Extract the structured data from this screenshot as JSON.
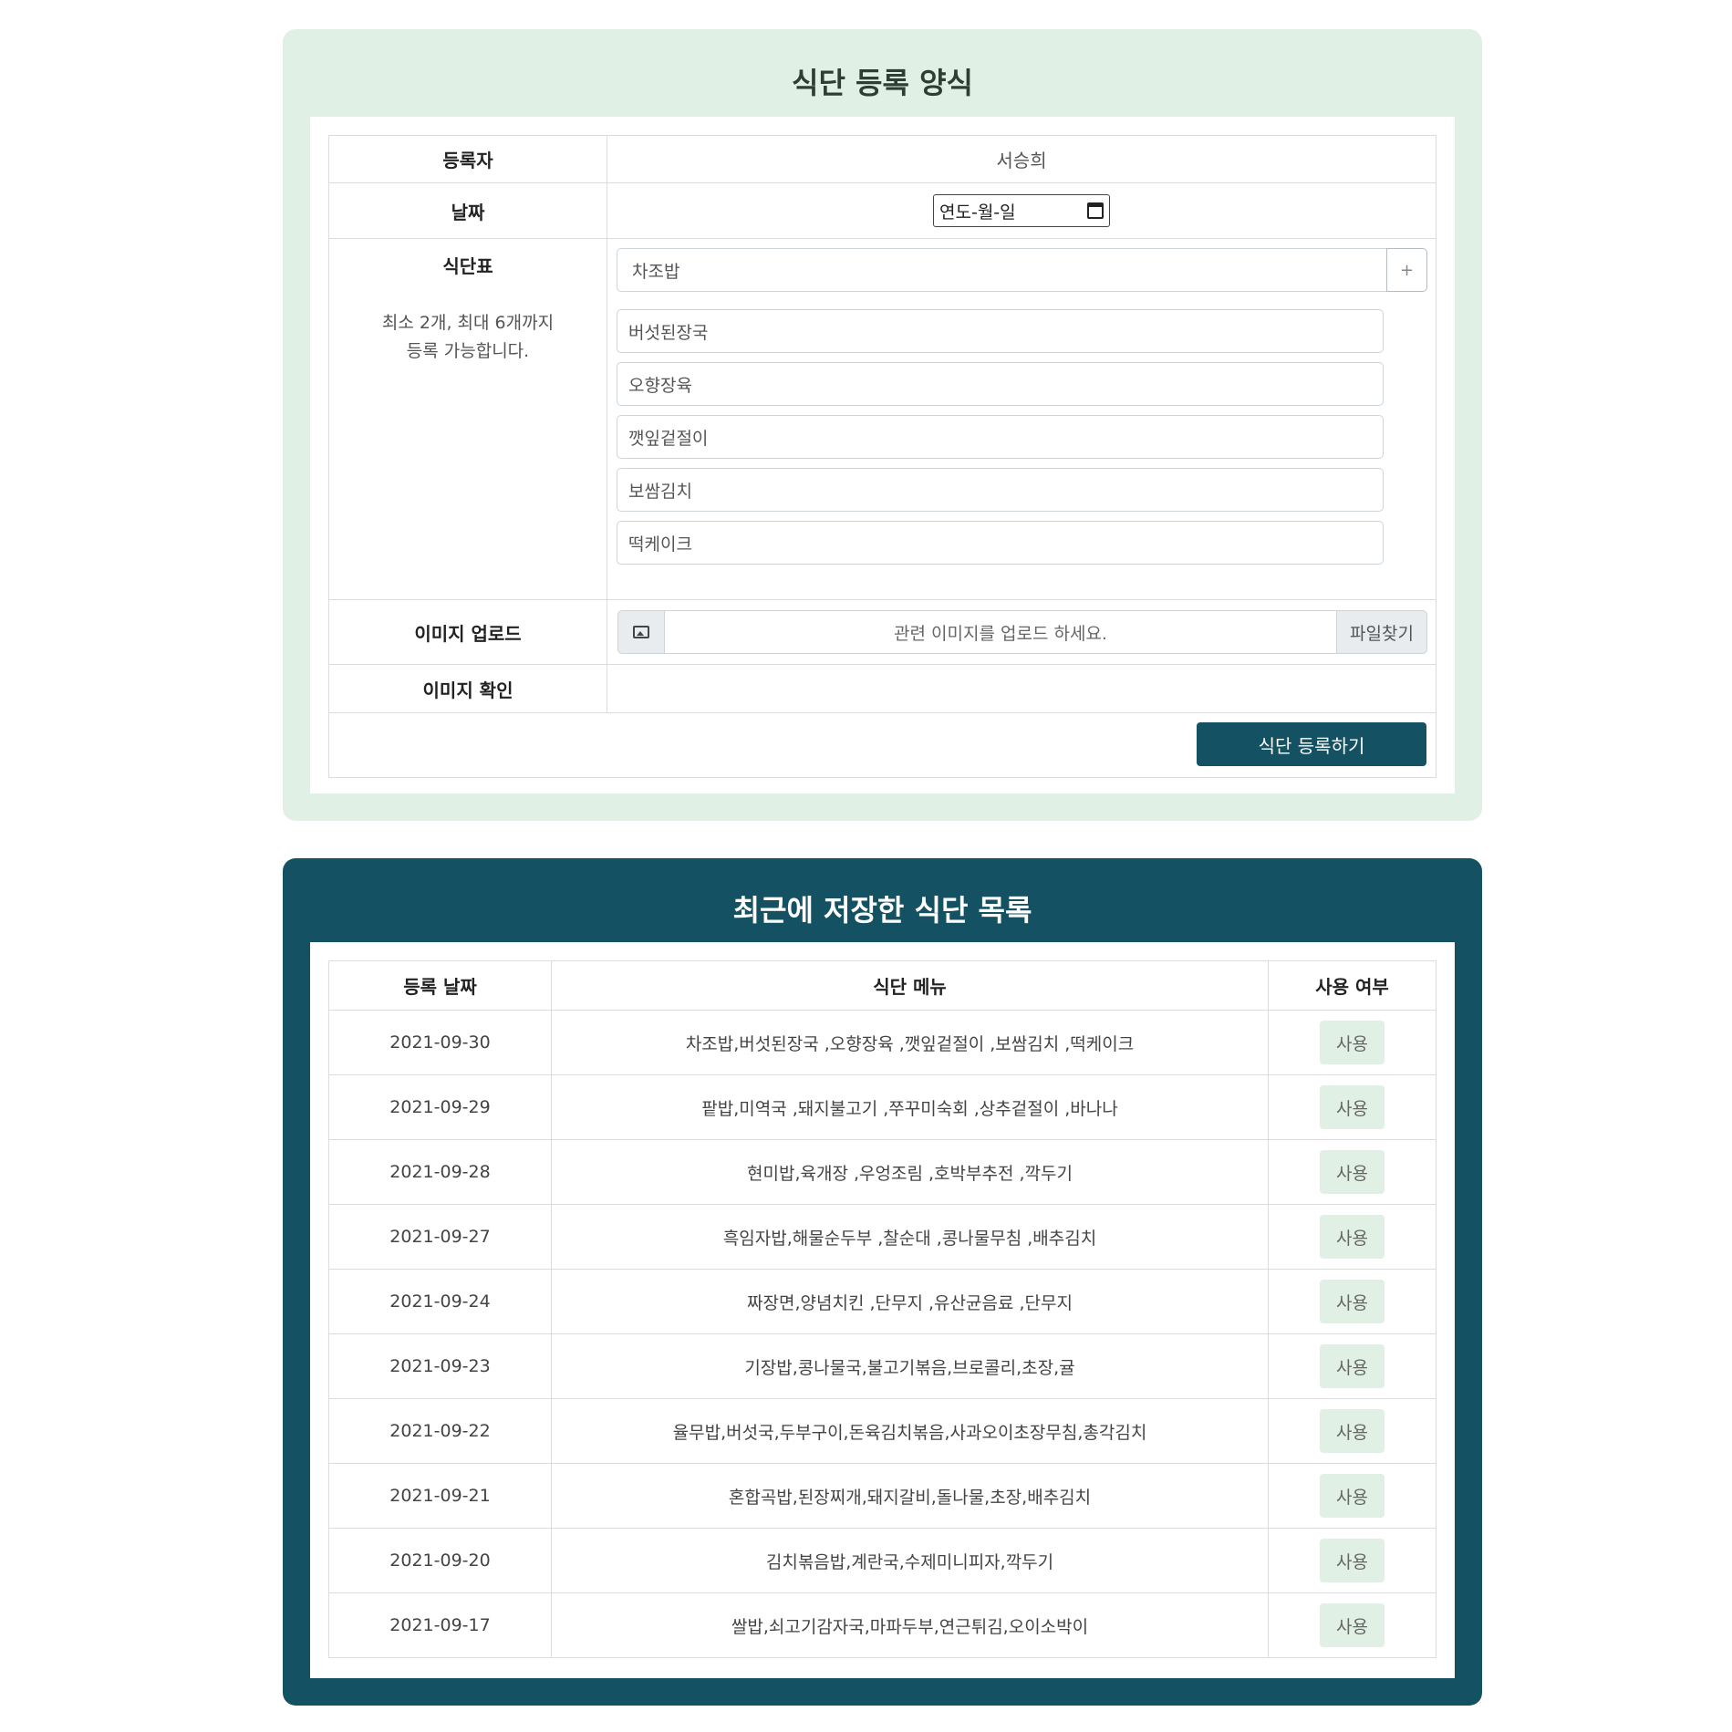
{
  "form": {
    "title": "식단 등록 양식",
    "registrant_label": "등록자",
    "registrant_value": "서승희",
    "date_label": "날짜",
    "date_placeholder": "연도-월-일",
    "menu_label": "식단표",
    "menu_hint_line1": "최소 2개, 최대 6개까지",
    "menu_hint_line2": "등록 가능합니다.",
    "menu_items": [
      "차조밥",
      "버섯된장국",
      "오향장육",
      "깻잎겉절이",
      "보쌈김치",
      "떡케이크"
    ],
    "add_button": "+",
    "image_upload_label": "이미지 업로드",
    "image_upload_placeholder": "관련 이미지를 업로드 하세요.",
    "file_button": "파일찾기",
    "image_check_label": "이미지 확인",
    "submit_button": "식단 등록하기"
  },
  "list": {
    "title": "최근에 저장한 식단 목록",
    "headers": [
      "등록 날짜",
      "식단 메뉴",
      "사용 여부"
    ],
    "rows": [
      {
        "date": "2021-09-30",
        "menu": "차조밥,버섯된장국 ,오향장육 ,깻잎겉절이 ,보쌈김치 ,떡케이크",
        "use": "사용"
      },
      {
        "date": "2021-09-29",
        "menu": "팥밥,미역국 ,돼지불고기 ,쭈꾸미숙회 ,상추겉절이 ,바나나",
        "use": "사용"
      },
      {
        "date": "2021-09-28",
        "menu": "현미밥,육개장 ,우엉조림 ,호박부추전 ,깍두기",
        "use": "사용"
      },
      {
        "date": "2021-09-27",
        "menu": "흑임자밥,해물순두부 ,찰순대 ,콩나물무침 ,배추김치",
        "use": "사용"
      },
      {
        "date": "2021-09-24",
        "menu": "짜장면,양념치킨 ,단무지 ,유산균음료 ,단무지",
        "use": "사용"
      },
      {
        "date": "2021-09-23",
        "menu": "기장밥,콩나물국,불고기볶음,브로콜리,초장,귤",
        "use": "사용"
      },
      {
        "date": "2021-09-22",
        "menu": "율무밥,버섯국,두부구이,돈육김치볶음,사과오이초장무침,총각김치",
        "use": "사용"
      },
      {
        "date": "2021-09-21",
        "menu": "혼합곡밥,된장찌개,돼지갈비,돌나물,초장,배추김치",
        "use": "사용"
      },
      {
        "date": "2021-09-20",
        "menu": "김치볶음밥,계란국,수제미니피자,깍두기",
        "use": "사용"
      },
      {
        "date": "2021-09-17",
        "menu": "쌀밥,쇠고기감자국,마파두부,연근튀김,오이소박이",
        "use": "사용"
      }
    ]
  },
  "colors": {
    "form_panel_bg": "#e1f0e5",
    "list_panel_bg": "#145263",
    "submit_button_bg": "#145263",
    "use_button_bg": "#e1f0e5"
  }
}
